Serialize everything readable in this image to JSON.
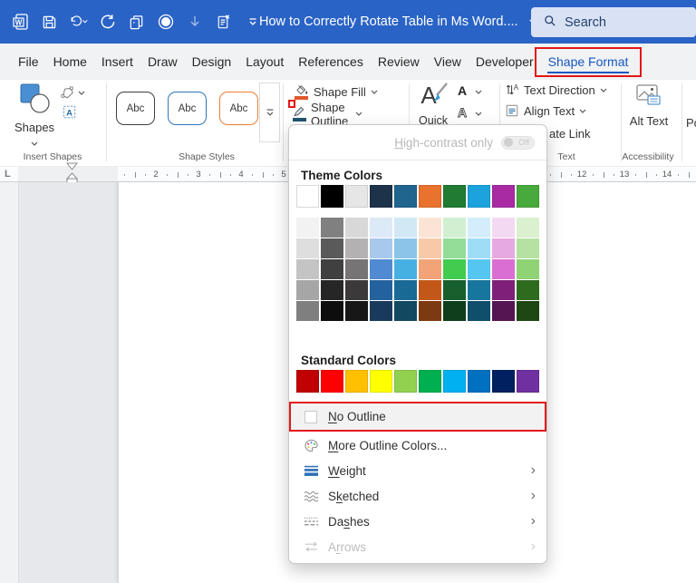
{
  "title_bar": {
    "title": "How to Correctly Rotate Table in Ms Word....",
    "search_placeholder": "Search",
    "qat_icons": [
      "word-logo-icon",
      "save-icon",
      "undo-icon",
      "redo-icon",
      "copy-icon",
      "record-icon",
      "down-arrow-icon",
      "paste-icon",
      "qat-menu-icon"
    ],
    "colors": {
      "bg": "#2a63c6",
      "search_bg": "#d8e2f4"
    }
  },
  "ribbon_tabs": {
    "items": [
      "File",
      "Home",
      "Insert",
      "Draw",
      "Design",
      "Layout",
      "References",
      "Review",
      "View",
      "Developer",
      "Shape Format"
    ],
    "active": "Shape Format"
  },
  "ribbon": {
    "insert_shapes": {
      "shapes_label": "Shapes",
      "group_label": "Insert Shapes"
    },
    "shape_styles": {
      "group_label": "Shape Styles",
      "styles": [
        {
          "label": "Abc",
          "border": "#3f3f3f"
        },
        {
          "label": "Abc",
          "border": "#2e75b6"
        },
        {
          "label": "Abc",
          "border": "#ed7d31"
        }
      ]
    },
    "fill_outline": {
      "shape_fill": "Shape Fill",
      "shape_fill_bar": "#e2572b",
      "shape_outline": "Shape Outline",
      "shape_outline_bar": "#20566e"
    },
    "wordart": {
      "quick_label": "Quick"
    },
    "text_group": {
      "text_direction": "Text Direction",
      "align_text": "Align Text",
      "create_link_fragment": "ate Link",
      "group_label": "Text"
    },
    "accessibility": {
      "alt_text": "Alt Text",
      "group_label": "Accessibility"
    },
    "arrange_fragment": "Po"
  },
  "dropdown": {
    "high_contrast": {
      "label": "High-contrast only",
      "accel": "H",
      "toggle_label": "Off"
    },
    "theme_heading": "Theme Colors",
    "theme_colors": [
      "#FFFFFF",
      "#000000",
      "#E7E6E6",
      "#1D3349",
      "#20658E",
      "#E8722E",
      "#217B33",
      "#1CA3DD",
      "#A82BA4",
      "#48A93C"
    ],
    "theme_shades": [
      [
        "#F2F2F2",
        "#DEDEDE",
        "#C4C4C4",
        "#A6A6A6",
        "#7F7F7F"
      ],
      [
        "#808080",
        "#5A5A5A",
        "#404040",
        "#262626",
        "#0D0D0D"
      ],
      [
        "#D9D8D8",
        "#B3B1B1",
        "#767474",
        "#3B3939",
        "#181717"
      ],
      [
        "#DCE9F7",
        "#A9C9EC",
        "#4F8AD2",
        "#24619F",
        "#1A3A5C"
      ],
      [
        "#D2E8F5",
        "#8AC4E8",
        "#47B0E2",
        "#1A6A96",
        "#124860"
      ],
      [
        "#FBE4D5",
        "#F7C9A8",
        "#F2A377",
        "#C35718",
        "#7C3A10"
      ],
      [
        "#D2EFD2",
        "#92DD98",
        "#41CC50",
        "#17602D",
        "#0E3E1C"
      ],
      [
        "#D3EEFA",
        "#9FDCF5",
        "#55C6F0",
        "#17769E",
        "#104F6B"
      ],
      [
        "#F4D9F2",
        "#E6A9E1",
        "#DB6ED3",
        "#7E2079",
        "#541552"
      ],
      [
        "#DAF0CF",
        "#B5E2A2",
        "#8FD374",
        "#2F6B1E",
        "#1F4714"
      ]
    ],
    "standard_heading": "Standard Colors",
    "standard_colors": [
      "#C00000",
      "#FF0000",
      "#FFC000",
      "#FFFF00",
      "#92D050",
      "#00B050",
      "#00B0F0",
      "#0070C0",
      "#002060",
      "#7030A0"
    ],
    "items": [
      {
        "label": "No Outline",
        "accel": "N",
        "icon": "no-outline",
        "highlighted": true,
        "annotated": true
      },
      {
        "label": "More Outline Colors...",
        "accel": "M",
        "icon": "palette"
      },
      {
        "label": "Weight",
        "accel": "W",
        "icon": "weight",
        "submenu": true
      },
      {
        "label": "Sketched",
        "accel": "k",
        "icon": "sketched",
        "submenu": true
      },
      {
        "label": "Dashes",
        "accel": "s",
        "icon": "dashes",
        "submenu": true
      },
      {
        "label": "Arrows",
        "accel": "r",
        "icon": "arrows",
        "submenu": true,
        "disabled": true
      }
    ]
  },
  "ruler": {
    "tab_selector": "L",
    "numbers": [
      2,
      3,
      4,
      5,
      12,
      13,
      14
    ]
  },
  "annotation_color": "#e31717"
}
